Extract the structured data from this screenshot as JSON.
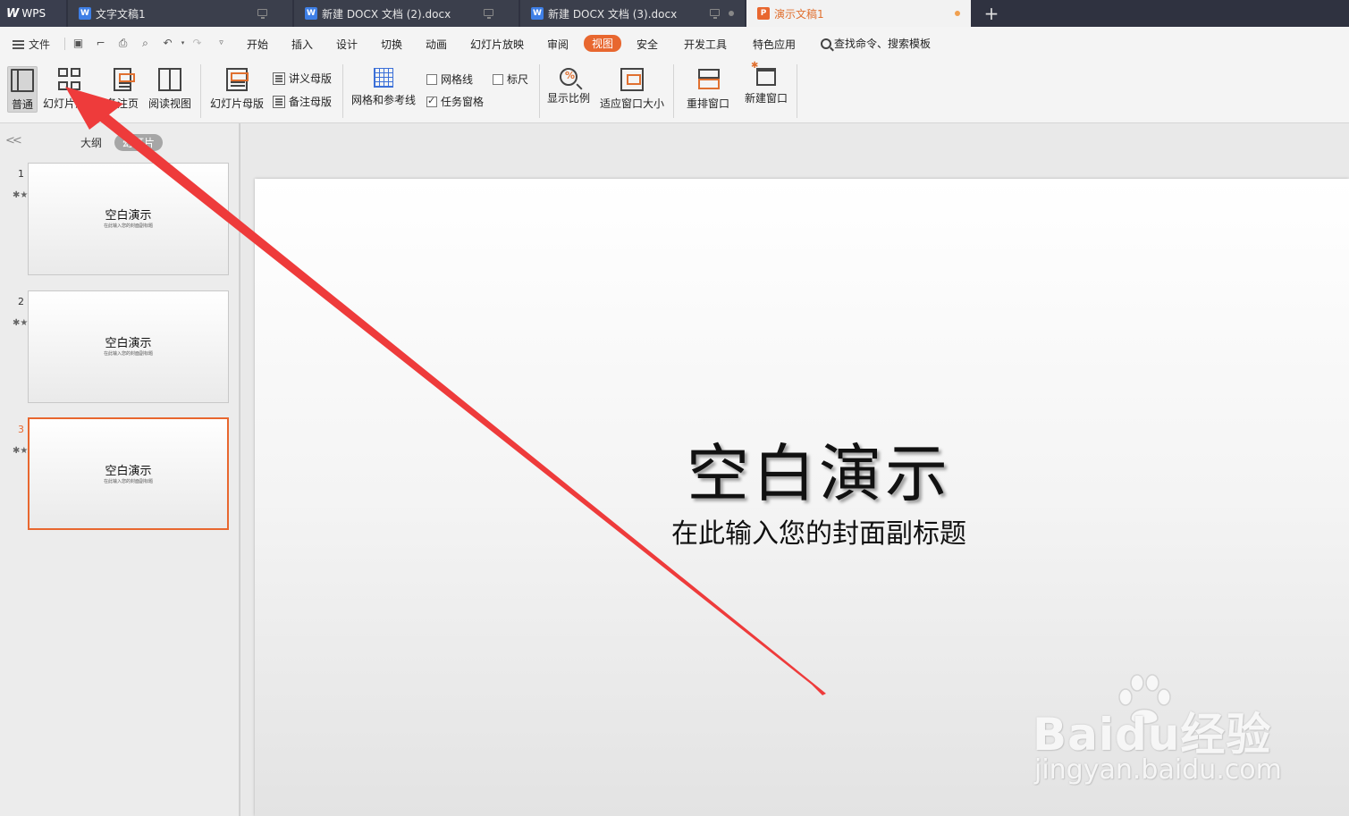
{
  "app": {
    "logo_label": "WPS",
    "accent_color": "#e8672f"
  },
  "tabs": [
    {
      "label": "文字文稿1",
      "icon": "writer-doc-icon"
    },
    {
      "label": "新建 DOCX 文档 (2).docx",
      "icon": "writer-doc-icon"
    },
    {
      "label": "新建 DOCX 文档 (3).docx",
      "icon": "writer-doc-icon"
    },
    {
      "label": "演示文稿1",
      "icon": "presentation-doc-icon",
      "active": true
    }
  ],
  "menu": {
    "file_label": "文件",
    "items": [
      "开始",
      "插入",
      "设计",
      "切换",
      "动画",
      "幻灯片放映",
      "审阅",
      "视图",
      "安全",
      "开发工具",
      "特色应用"
    ],
    "active_item": "视图",
    "search_label": "查找命令、搜索模板"
  },
  "ribbon": {
    "normal": "普通",
    "slide_sorter": "幻灯片浏览",
    "notes_page": "备注页",
    "reading_view": "阅读视图",
    "slide_master": "幻灯片母版",
    "handout_master": "讲义母版",
    "notes_master": "备注母版",
    "grid_and_guides": "网格和参考线",
    "gridlines": {
      "label": "网格线",
      "checked": false
    },
    "ruler": {
      "label": "标尺",
      "checked": false
    },
    "task_pane": {
      "label": "任务窗格",
      "checked": true
    },
    "zoom": "显示比例",
    "fit_window": "适应窗口大小",
    "arrange_windows": "重排窗口",
    "new_window": "新建窗口",
    "selected_view": "普通"
  },
  "left_pane": {
    "tab_outline": "大纲",
    "tab_slides": "幻灯片",
    "active_tab": "幻灯片",
    "thumbnails": [
      {
        "number": "1",
        "title": "空白演示",
        "subtitle": "在此输入您的封面副标题"
      },
      {
        "number": "2",
        "title": "空白演示",
        "subtitle": "在此输入您的封面副标题"
      },
      {
        "number": "3",
        "title": "空白演示",
        "subtitle": "在此输入您的封面副标题",
        "current": true
      }
    ]
  },
  "slide": {
    "title": "空白演示",
    "subtitle": "在此输入您的封面副标题"
  },
  "watermark": {
    "brand": "Bai",
    "brand_du": "du",
    "brand_cn": "经验",
    "url": "jingyan.baidu.com"
  }
}
